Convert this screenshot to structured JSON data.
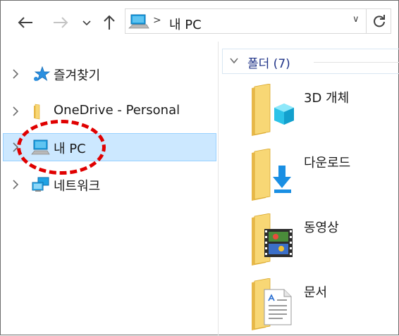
{
  "window": {
    "title": "내 PC"
  },
  "toolbar": {
    "back_icon": "arrow-left-icon",
    "forward_icon": "arrow-right-icon",
    "recent_icon": "chevron-down-icon",
    "up_icon": "arrow-up-icon"
  },
  "address_bar": {
    "location_icon": "computer-icon",
    "separator": ">",
    "path": "내 PC",
    "dropdown": "∨",
    "refresh_icon": "refresh-icon"
  },
  "navigation_pane": {
    "items": [
      {
        "label": "즐겨찾기",
        "icon": "star-icon",
        "selected": false
      },
      {
        "label": "OneDrive - Personal",
        "icon": "onedrive-folder-icon",
        "selected": false
      },
      {
        "label": "내 PC",
        "icon": "computer-icon",
        "selected": true
      },
      {
        "label": "네트워크",
        "icon": "network-icon",
        "selected": false
      }
    ]
  },
  "content": {
    "group": {
      "label": "폴더 (7)"
    },
    "folders": [
      {
        "label": "3D 개체",
        "icon": "3d-objects-folder-icon"
      },
      {
        "label": "다운로드",
        "icon": "downloads-folder-icon"
      },
      {
        "label": "동영상",
        "icon": "videos-folder-icon"
      },
      {
        "label": "문서",
        "icon": "documents-folder-icon"
      }
    ]
  },
  "colors": {
    "selection_bg": "#cce8ff",
    "selection_border": "#99d1ff",
    "annotation": "#e00000",
    "group_label": "#1e3287",
    "folder_yellow": "#f8d775"
  }
}
